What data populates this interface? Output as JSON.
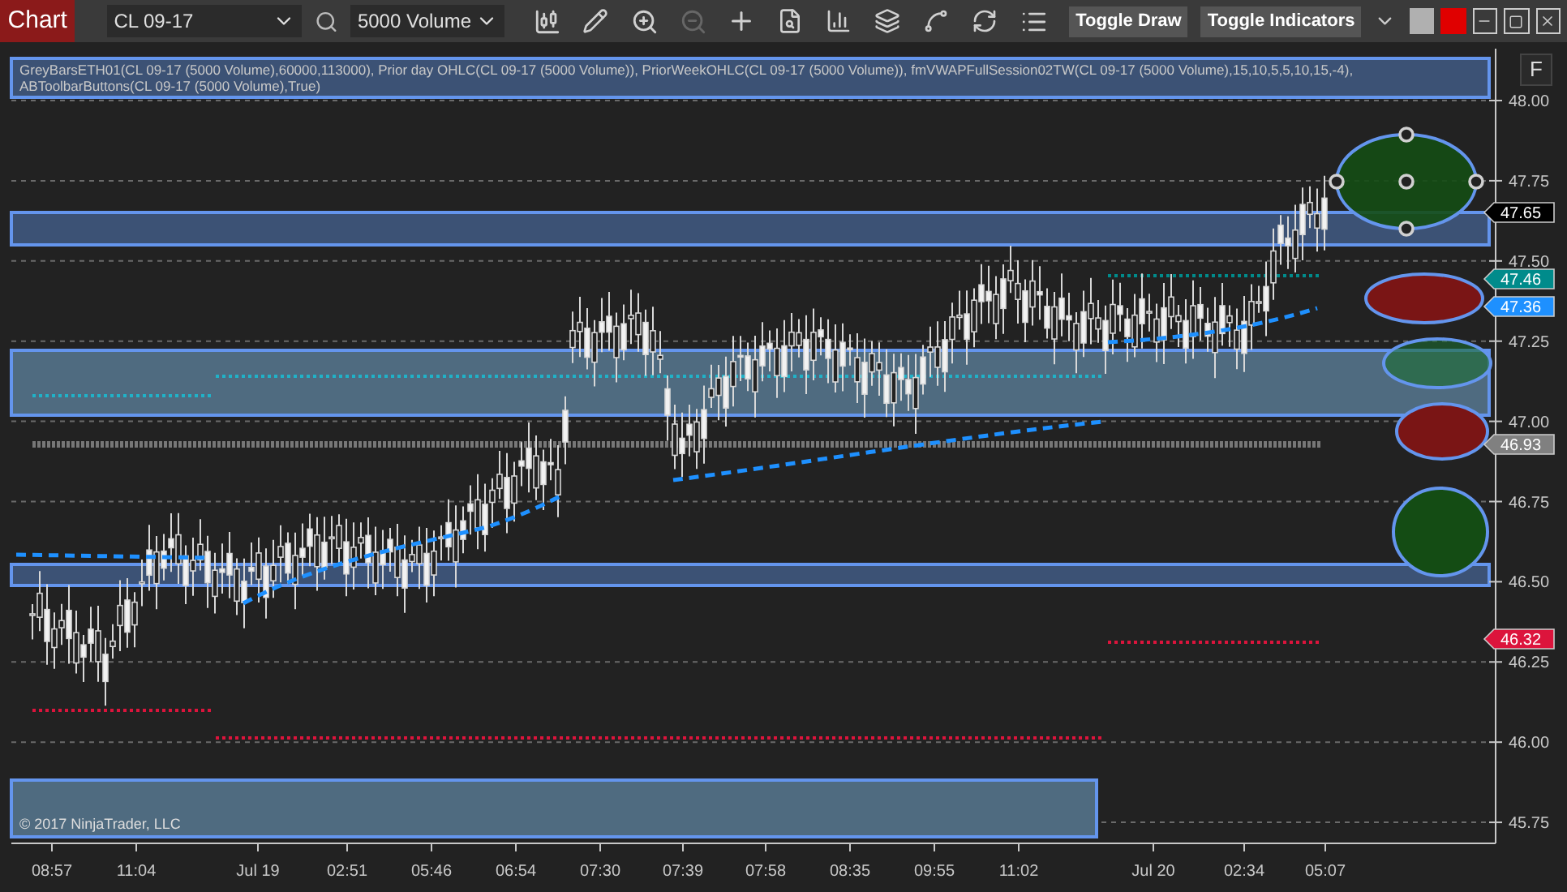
{
  "toolbar": {
    "title": "Chart",
    "instrument": "CL 09-17",
    "interval": "5000 Volume",
    "buttons": [
      "Toggle Draw",
      "Toggle Indicators"
    ]
  },
  "indicator_label": "GreyBarsETH01(CL 09-17 (5000 Volume),60000,113000), Prior day OHLC(CL 09-17 (5000 Volume)), PriorWeekOHLC(CL 09-17 (5000 Volume)), fmVWAPFullSession02TW(CL 09-17 (5000 Volume),15,10,5,5,10,15,-4), ABToolbarButtons(CL 09-17 (5000 Volume),True)",
  "panel_button": "F",
  "price_axis": {
    "ticks": [
      "48.00",
      "47.75",
      "47.50",
      "47.25",
      "47.00",
      "46.75",
      "46.50",
      "46.25",
      "46.00",
      "45.75"
    ]
  },
  "price_markers": [
    {
      "label": "47.65",
      "color": "#000000"
    },
    {
      "label": "47.46",
      "color": "#008b8b"
    },
    {
      "label": "47.36",
      "color": "#1e90ff"
    },
    {
      "label": "46.93",
      "color": "#808080"
    },
    {
      "label": "46.32",
      "color": "#dc143c"
    }
  ],
  "time_axis": {
    "labels": [
      "08:57",
      "11:04",
      "Jul 19",
      "02:51",
      "05:46",
      "06:54",
      "07:30",
      "07:39",
      "07:58",
      "08:35",
      "09:55",
      "11:02",
      "Jul 20",
      "02:34",
      "05:07"
    ]
  },
  "copyright": "© 2017 NinjaTrader, LLC"
}
